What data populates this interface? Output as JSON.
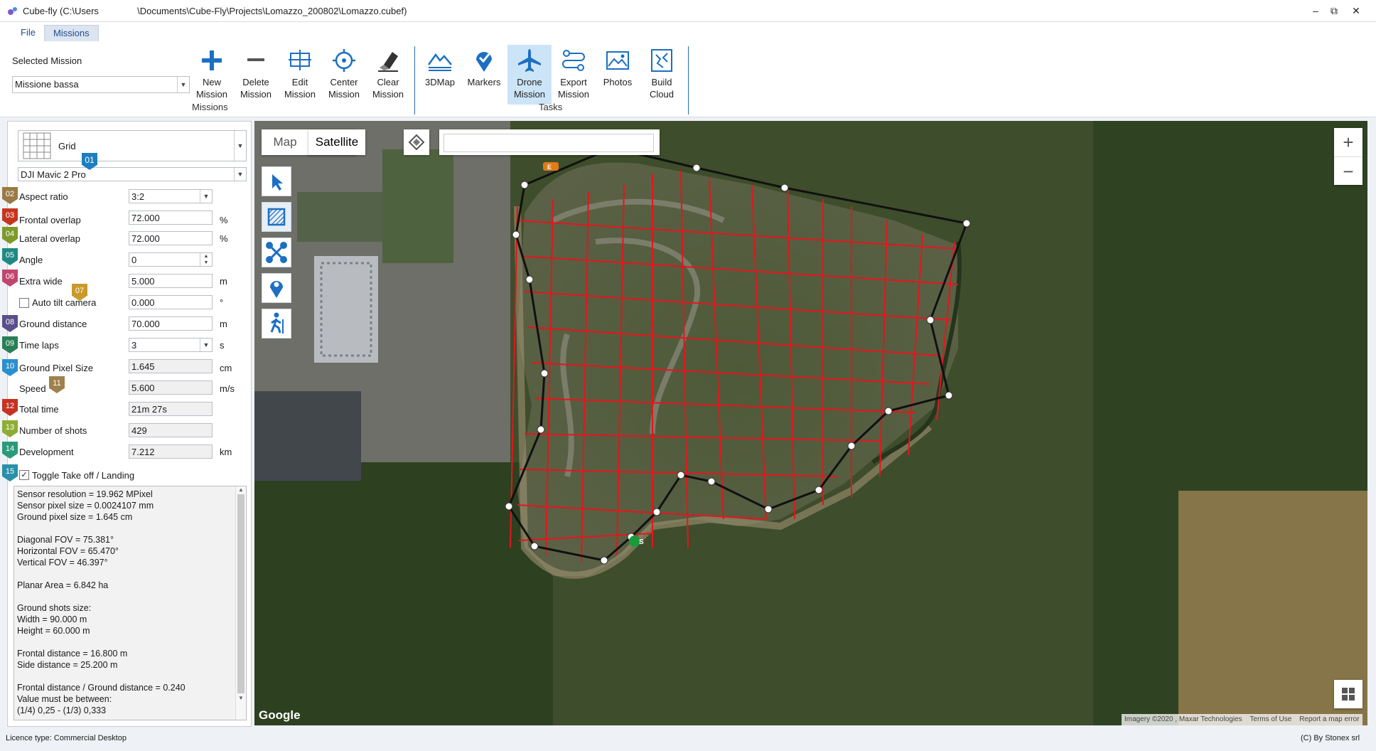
{
  "window": {
    "title": "Cube-fly (C:\\Users               \\Documents\\Cube-Fly\\Projects\\Lomazzo_200802\\Lomazzo.cubef)",
    "controls": [
      "–",
      "⧉",
      "✕"
    ]
  },
  "tabs": [
    {
      "label": "File",
      "active": false
    },
    {
      "label": "Missions",
      "active": true
    }
  ],
  "ribbon": {
    "selected_mission_label": "Selected Mission",
    "selected_mission_value": "Missione bassa",
    "missions_group": "Missions",
    "tasks_group": "Tasks",
    "buttons": {
      "new_mission": "New\nMission",
      "delete_mission": "Delete\nMission",
      "edit_mission": "Edit\nMission",
      "center_mission": "Center\nMission",
      "clear_mission": "Clear\nMission",
      "map3d": "3DMap",
      "markers": "Markers",
      "drone_mission": "Drone\nMission",
      "export_mission": "Export\nMission",
      "photos": "Photos",
      "build_cloud": "Build\nCloud"
    }
  },
  "panel": {
    "mission_type": "Grid",
    "drone": "DJI Mavic 2 Pro",
    "badges": [
      "01",
      "02",
      "03",
      "04",
      "05",
      "06",
      "07",
      "08",
      "09",
      "10",
      "11",
      "12",
      "13",
      "14",
      "15"
    ],
    "fields": {
      "aspect_ratio": {
        "label": "Aspect ratio",
        "value": "3:2"
      },
      "frontal_overlap": {
        "label": "Frontal overlap",
        "value": "72.000",
        "unit": "%"
      },
      "lateral_overlap": {
        "label": "Lateral overlap",
        "value": "72.000",
        "unit": "%"
      },
      "angle": {
        "label": "Angle",
        "value": "0"
      },
      "extra_wide": {
        "label": "Extra wide",
        "value": "5.000",
        "unit": "m"
      },
      "auto_tilt": {
        "label": "Auto tilt camera",
        "value": "0.000",
        "unit": "°",
        "checked": false
      },
      "ground_distance": {
        "label": "Ground distance",
        "value": "70.000",
        "unit": "m"
      },
      "time_laps": {
        "label": "Time laps",
        "value": "3",
        "unit": "s"
      },
      "ground_pixel_size": {
        "label": "Ground Pixel Size",
        "value": "1.645",
        "unit": "cm"
      },
      "speed": {
        "label": "Speed",
        "value": "5.600",
        "unit": "m/s"
      },
      "total_time": {
        "label": "Total time",
        "value": "21m 27s"
      },
      "number_of_shots": {
        "label": "Number of shots",
        "value": "429"
      },
      "development": {
        "label": "Development",
        "value": "7.212",
        "unit": "km"
      },
      "toggle_takeoff": {
        "label": "Toggle Take off / Landing",
        "checked": true
      }
    },
    "info": "Sensor resolution = 19.962 MPixel\nSensor pixel size = 0.0024107 mm\nGround pixel size = 1.645 cm\n\nDiagonal FOV = 75.381°\nHorizontal FOV = 65.470°\nVertical FOV = 46.397°\n\nPlanar Area = 6.842 ha\n\nGround shots size:\nWidth = 90.000 m\nHeight = 60.000 m\n\nFrontal distance = 16.800 m\nSide distance = 25.200 m\n\nFrontal distance / Ground distance = 0.240\nValue must be between:\n(1/4) 0,25 - (1/3) 0,333"
  },
  "map": {
    "type_map": "Map",
    "type_satellite": "Satellite",
    "search_value": "",
    "google_logo": "Google",
    "attribution": "Imagery ©2020 , Maxar Technologies",
    "terms": "Terms of Use",
    "report": "Report a map error",
    "marker_start": "S",
    "marker_end": "E",
    "zoom_in": "+",
    "zoom_out": "−",
    "colors": {
      "grid": "#e8141c",
      "path": "#111111",
      "vertex": "#ffffff"
    }
  },
  "status": {
    "licence": "Licence type: Commercial Desktop",
    "copyright": "(C) By Stonex srl"
  }
}
